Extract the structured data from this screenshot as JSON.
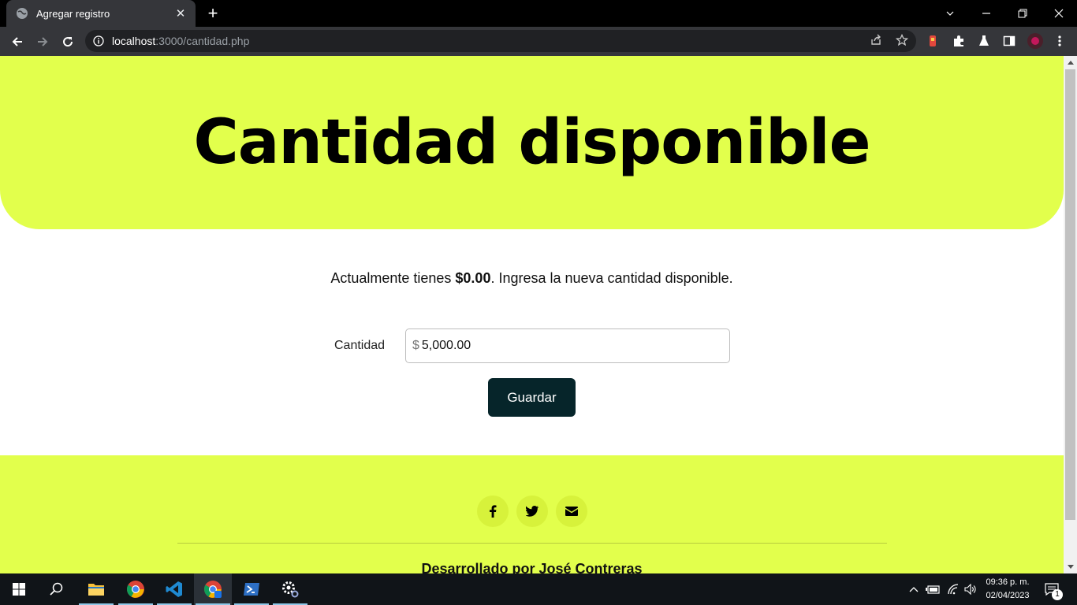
{
  "browser": {
    "tab_title": "Agregar registro",
    "url_host": "localhost",
    "url_rest": ":3000/cantidad.php"
  },
  "page": {
    "hero_title": "Cantidad disponible",
    "intro_before": "Actualmente tienes ",
    "intro_amount": "$0.00",
    "intro_after": ". Ingresa la nueva cantidad disponible.",
    "form": {
      "label": "Cantidad",
      "prefix": "$",
      "value": "5,000.00"
    },
    "save_label": "Guardar",
    "footer": {
      "social": [
        "facebook-icon",
        "twitter-icon",
        "envelope-icon"
      ],
      "credit": "Desarrollado por José Contreras"
    }
  },
  "taskbar": {
    "time": "09:36 p. m.",
    "date": "02/04/2023",
    "notification_count": "1"
  },
  "colors": {
    "accent": "#e2ff4c",
    "button": "#06252a"
  }
}
